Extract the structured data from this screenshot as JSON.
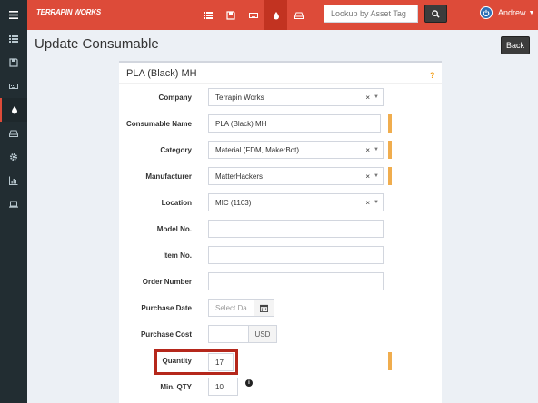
{
  "navbar": {
    "brand": "TERRAPIN WORKS",
    "icons": [
      "list-icon",
      "save-icon",
      "keyboard-icon",
      "tint-icon",
      "hdd-icon"
    ],
    "lookup_placeholder": "Lookup by Asset Tag",
    "user_name": "Andrew",
    "accent": "#dd4b39"
  },
  "sidebar": {
    "icons": [
      "list-icon",
      "save-icon",
      "keyboard-icon",
      "tint-icon",
      "hdd-icon",
      "gear-icon",
      "chart-icon",
      "laptop-icon"
    ]
  },
  "page": {
    "title": "Update Consumable",
    "back_label": "Back"
  },
  "form": {
    "header": "PLA (Black) MH",
    "help": "?",
    "company_label": "Company",
    "company_value": "Terrapin Works",
    "name_label": "Consumable Name",
    "name_value": "PLA (Black) MH",
    "category_label": "Category",
    "category_value": "Material (FDM, MakerBot)",
    "manufacturer_label": "Manufacturer",
    "manufacturer_value": "MatterHackers",
    "location_label": "Location",
    "location_value": "MIC (1103)",
    "model_label": "Model No.",
    "model_value": "",
    "item_label": "Item No.",
    "item_value": "",
    "order_label": "Order Number",
    "order_value": "",
    "purchase_date_label": "Purchase Date",
    "purchase_date_placeholder": "Select Da",
    "purchase_cost_label": "Purchase Cost",
    "purchase_cost_value": "",
    "currency": "USD",
    "quantity_label": "Quantity",
    "quantity_value": "17",
    "minqty_label": "Min. QTY",
    "minqty_value": "10",
    "clear_symbol": "×",
    "dropdown_symbol": "▼",
    "info_symbol": "i"
  }
}
